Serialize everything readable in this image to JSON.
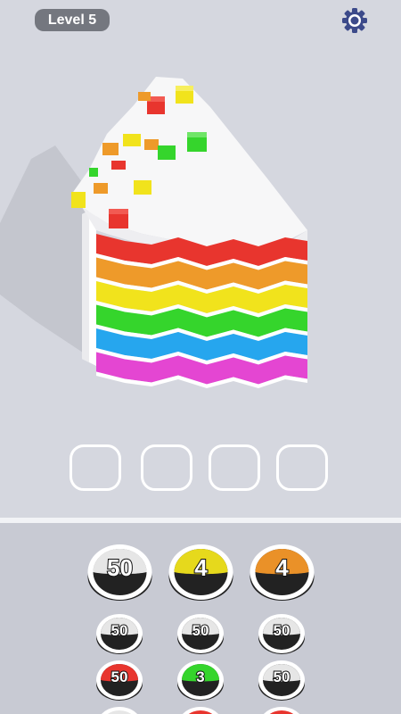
{
  "hud": {
    "level_label": "Level 5",
    "settings_icon": "gear-icon"
  },
  "colors": {
    "background": "#d5d7df",
    "tray": "#c8cad3",
    "red": "#e8352e",
    "orange": "#ee9a2a",
    "yellow": "#f1e31c",
    "green": "#35d52c",
    "blue": "#26a6ee",
    "magenta": "#e446d2"
  },
  "cake": {
    "layers": [
      "red",
      "orange",
      "yellow",
      "green",
      "blue",
      "magenta"
    ],
    "frosting": "white"
  },
  "slots": {
    "count": 4
  },
  "coins": {
    "featured": [
      {
        "value": "50",
        "color": "white"
      },
      {
        "value": "4",
        "color": "yellow"
      },
      {
        "value": "4",
        "color": "orange"
      }
    ],
    "row1": [
      {
        "value": "50",
        "color": "white"
      },
      {
        "value": "50",
        "color": "white"
      },
      {
        "value": "50",
        "color": "white"
      }
    ],
    "row2": [
      {
        "value": "50",
        "color": "red"
      },
      {
        "value": "3",
        "color": "green"
      },
      {
        "value": "50",
        "color": "white"
      }
    ]
  }
}
